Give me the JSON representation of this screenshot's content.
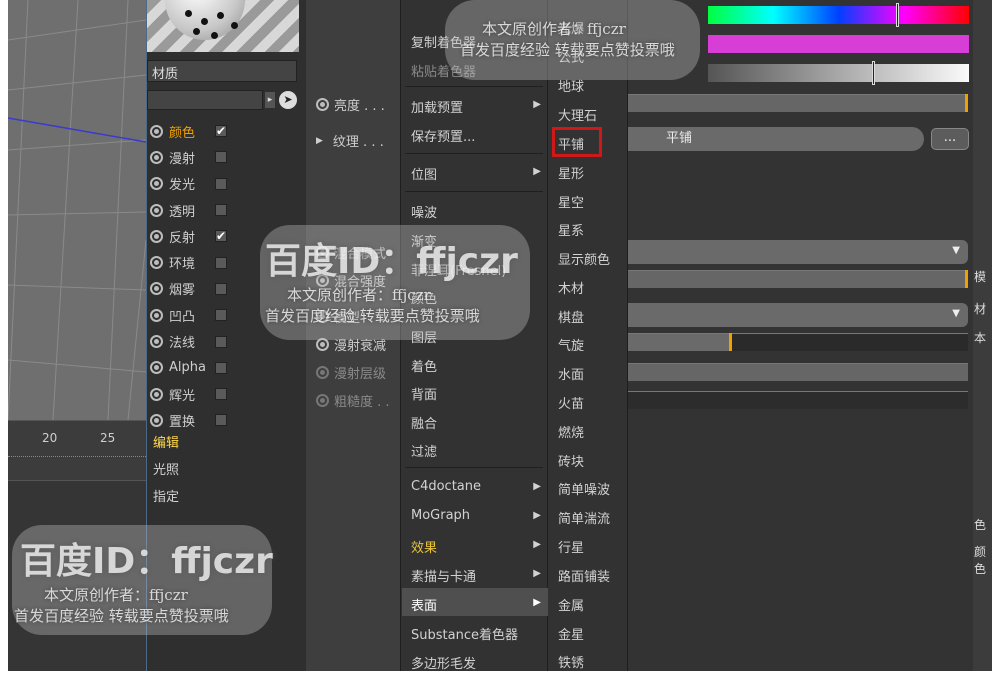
{
  "viewport": {
    "timeline_numbers": [
      "20",
      "25"
    ]
  },
  "material": {
    "name_label": "材质",
    "channels": [
      {
        "label": "颜色",
        "checked": "✔",
        "active": true
      },
      {
        "label": "漫射",
        "checked": ""
      },
      {
        "label": "发光",
        "checked": ""
      },
      {
        "label": "透明",
        "checked": ""
      },
      {
        "label": "反射",
        "checked": "✔"
      },
      {
        "label": "环境",
        "checked": ""
      },
      {
        "label": "烟雾",
        "checked": ""
      },
      {
        "label": "凹凸",
        "checked": ""
      },
      {
        "label": "法线",
        "checked": ""
      },
      {
        "label": "Alpha",
        "checked": ""
      },
      {
        "label": "辉光",
        "checked": ""
      },
      {
        "label": "置换",
        "checked": ""
      }
    ],
    "sections": [
      {
        "label": "编辑",
        "active": true
      },
      {
        "label": "光照"
      },
      {
        "label": "指定"
      }
    ]
  },
  "attributes": {
    "rows": [
      "亮度 . . .",
      "纹理 . . .",
      "混合模式",
      "混合强度",
      "模型",
      "漫射衰减",
      "漫射层级",
      "粗糙度 . ."
    ]
  },
  "menu1": {
    "items": [
      "复制着色器",
      "粘贴着色器",
      "加载预置",
      "保存预置...",
      "位图",
      "噪波",
      "渐变",
      "菲涅耳(Fresnel)",
      "颜色",
      "图层",
      "着色",
      "背面",
      "融合",
      "过滤",
      "C4doctane",
      "MoGraph",
      "效果",
      "素描与卡通",
      "表面",
      "Substance着色器",
      "多边形毛发"
    ]
  },
  "menu2": {
    "items": [
      "光爆",
      "公式",
      "地球",
      "大理石",
      "平铺",
      "星形",
      "星空",
      "星系",
      "显示颜色",
      "木材",
      "棋盘",
      "气旋",
      "水面",
      "火苗",
      "燃烧",
      "砖块",
      "简单噪波",
      "简单湍流",
      "行星",
      "路面铺装",
      "金属",
      "金星",
      "铁锈"
    ]
  },
  "right": {
    "texture_name": "平铺",
    "dots_label": "...",
    "far_labels": [
      "模",
      "材",
      "本",
      "色",
      "颜色"
    ]
  },
  "watermark": {
    "logo": "百度ID：ffjczr",
    "author": "本文原创作者：ffjczr",
    "note": "首发百度经验  转载要点赞投票哦"
  },
  "colors": {
    "accent_orange": "#f0a000",
    "active_yellow": "#ffd84a",
    "highlight_red": "#d01818"
  }
}
